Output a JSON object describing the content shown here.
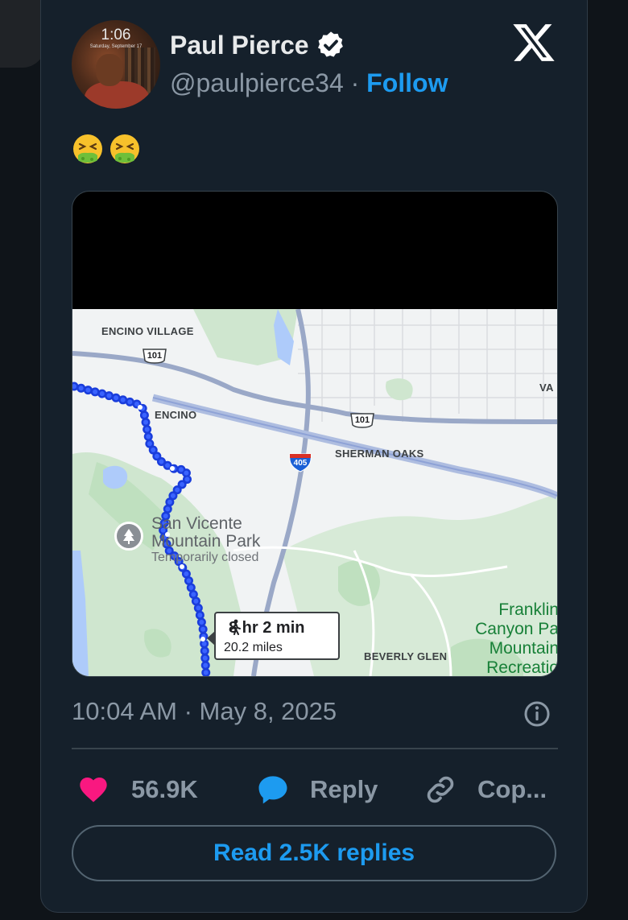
{
  "tweet": {
    "avatar": {
      "time": "1:06",
      "date": "Saturday, September 17"
    },
    "author_name": "Paul Pierce",
    "handle": "@paulpierce34",
    "separator": "·",
    "follow_label": "Follow",
    "emoji_text": "🤮🤮",
    "timestamp": "10:04 AM · May 8, 2025"
  },
  "map": {
    "labels": {
      "encino_village": "ENCINO VILLAGE",
      "encino": "ENCINO",
      "sherman_oaks": "SHERMAN OAKS",
      "beverly_glen": "BEVERLY GLEN",
      "va": "VA",
      "park_line1": "San Vicente",
      "park_line2": "Mountain Park",
      "park_status": "Temporarily closed",
      "franklin_line1": "Franklin",
      "franklin_line2": "Canyon Pa",
      "franklin_line3": "Mountain",
      "franklin_line4": "Recreatio"
    },
    "shields": {
      "us101_a": "101",
      "us101_b": "101",
      "i405": "405"
    },
    "route": {
      "duration": "8 hr 2 min",
      "distance": "20.2 miles",
      "mode_icon": "walking-person-icon"
    }
  },
  "actions": {
    "likes": "56.9K",
    "reply_label": "Reply",
    "copy_label": "Cop..."
  },
  "read_replies_label": "Read 2.5K replies",
  "colors": {
    "accent": "#1d9bf0",
    "like": "#f91880",
    "background": "#15202b",
    "route": "#1a3ddb"
  }
}
